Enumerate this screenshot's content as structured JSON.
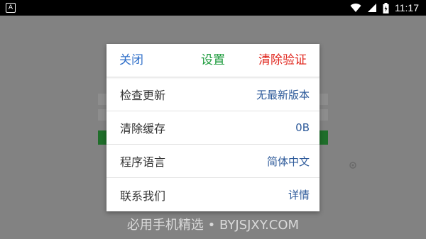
{
  "status_bar": {
    "left_icon": "A",
    "time": "11:17",
    "icons": [
      "wifi-icon",
      "signal-icon",
      "battery-icon"
    ]
  },
  "dialog": {
    "header": {
      "close_label": "关闭",
      "title": "设置",
      "clear_verify_label": "清除验证"
    },
    "rows": [
      {
        "label": "检查更新",
        "value": "无最新版本"
      },
      {
        "label": "清除缓存",
        "value": "0B"
      },
      {
        "label": "程序语言",
        "value": "简体中文"
      },
      {
        "label": "联系我们",
        "value": "详情"
      }
    ]
  },
  "watermark": "必用手机精选 • BYJSJXY.COM",
  "colors": {
    "close": "#2f6fc9",
    "title": "#1a9a3a",
    "clear_verify": "#e0241b",
    "value_text": "#2d5a9a"
  }
}
